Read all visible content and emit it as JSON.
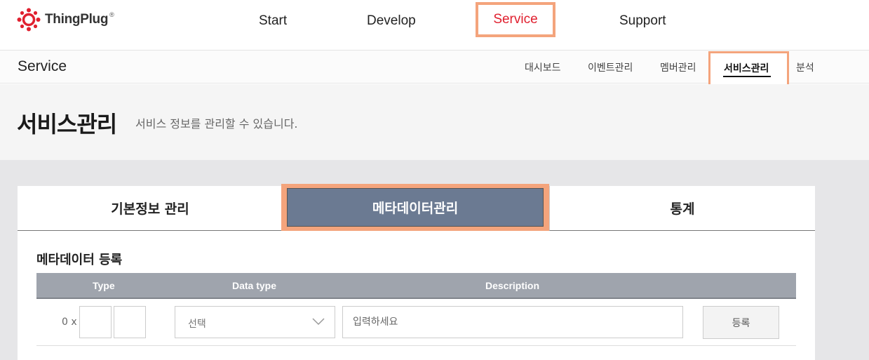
{
  "brand": {
    "name": "ThingPlug",
    "reg": "®",
    "logo_icon": "sun-gear-icon",
    "accent": "#e0202f"
  },
  "topnav": {
    "items": [
      "Start",
      "Develop",
      "Service",
      "Support"
    ],
    "active": "Service"
  },
  "subnav": {
    "title": "Service",
    "items": [
      "대시보드",
      "이벤트관리",
      "멤버관리",
      "서비스관리",
      "분석"
    ],
    "active": "서비스관리"
  },
  "page": {
    "title": "서비스관리",
    "description": "서비스 정보를 관리할 수 있습니다."
  },
  "tabs": {
    "items": [
      "기본정보 관리",
      "메타데이터관리",
      "통계"
    ],
    "active": "메타데이터관리"
  },
  "section": {
    "title": "메타데이터 등록"
  },
  "table": {
    "headers": [
      "Type",
      "Data type",
      "Description"
    ],
    "row": {
      "hex_prefix": "0 x",
      "select_value": "선택",
      "description_placeholder": "입력하세요",
      "submit_label": "등록"
    }
  },
  "colors": {
    "highlight": "#f4a47c",
    "active_tab": "#6b7a92",
    "table_header": "#9fa4ad"
  }
}
